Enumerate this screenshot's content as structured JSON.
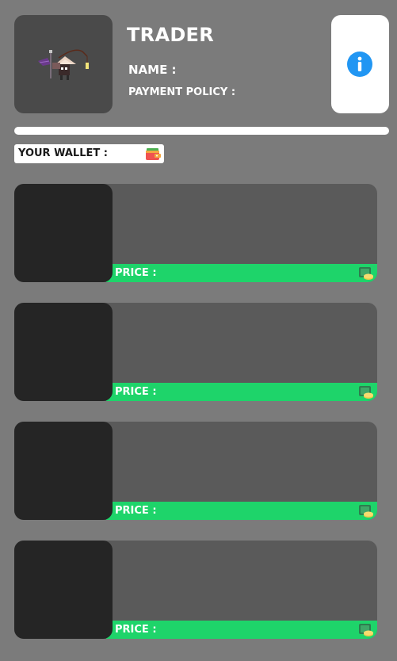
{
  "header": {
    "title": "TRADER",
    "name_label": "NAME :",
    "payment_policy_label": "PAYMENT POLICY :"
  },
  "wallet": {
    "label": "YOUR WALLET :"
  },
  "items": [
    {
      "price_label": "PRICE :"
    },
    {
      "price_label": "PRICE :"
    },
    {
      "price_label": "PRICE :"
    },
    {
      "price_label": "PRICE :"
    }
  ],
  "icons": {
    "info": "info-icon",
    "wallet": "wallet-icon",
    "price": "coin-cash-icon",
    "portrait": "trader-sprite"
  },
  "colors": {
    "background": "#7b7b7b",
    "accent_green": "#1ed46a",
    "info_blue": "#2196f3",
    "card": "#5a5a5a",
    "thumb": "#252525"
  }
}
